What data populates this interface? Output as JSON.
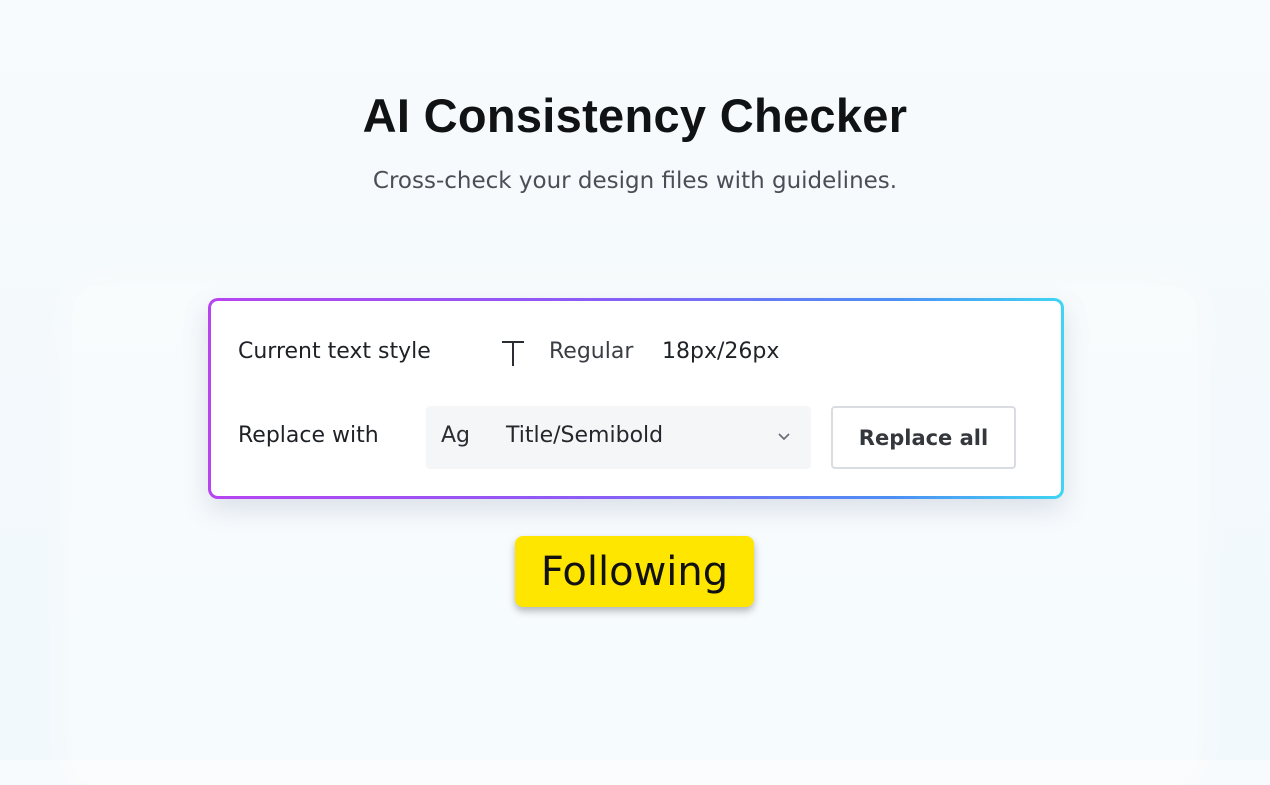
{
  "header": {
    "title": "AI Consistency Checker",
    "subtitle": "Cross-check your design files with guidelines."
  },
  "panel": {
    "current_label": "Current text style",
    "current_style_icon": "text-t-icon",
    "current_style_name": "Regular",
    "current_style_size": "18px/26px",
    "replace_label": "Replace with",
    "replace_select": {
      "prefix": "Ag",
      "value": "Title/Semibold",
      "icon": "chevron-down-icon"
    },
    "replace_button_label": "Replace all",
    "accent_gradient": [
      "#b644f1",
      "#8b5cf6",
      "#4d8ff5",
      "#3fd5f2"
    ]
  },
  "badge": {
    "label": "Following",
    "color": "#ffe600"
  }
}
